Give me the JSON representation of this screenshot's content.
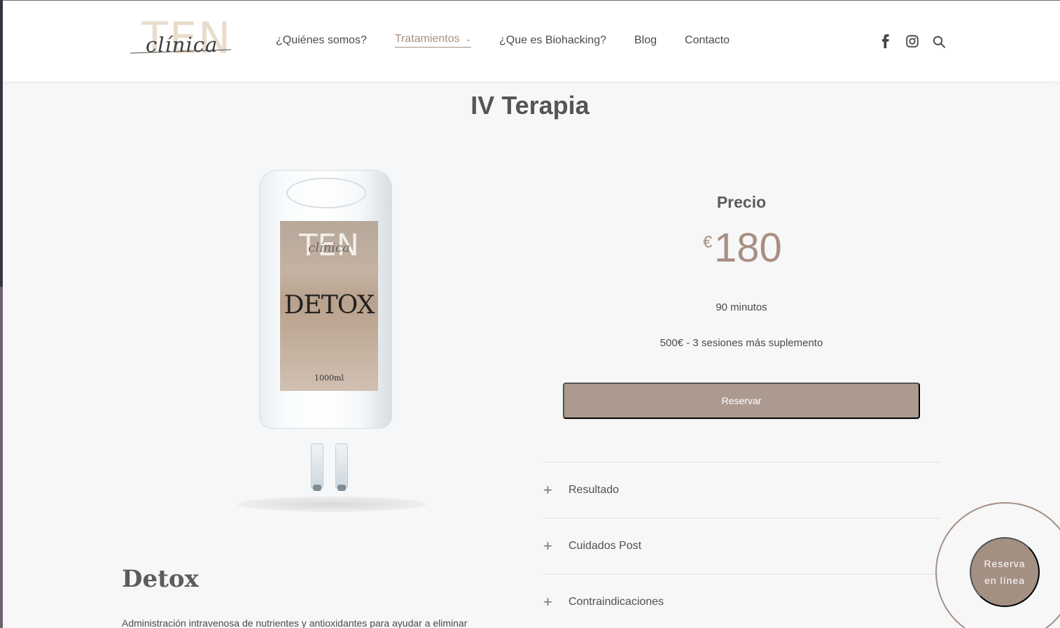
{
  "logo": {
    "top": "TEN",
    "script": "clínica"
  },
  "nav": [
    {
      "label": "¿Quiénes somos?"
    },
    {
      "label": "Tratamientos"
    },
    {
      "label": "¿Que es Biohacking?"
    },
    {
      "label": "Blog"
    },
    {
      "label": "Contacto"
    }
  ],
  "icons": {
    "facebook": "facebook-icon",
    "instagram": "instagram-icon",
    "search": "search-icon"
  },
  "page_title": "IV Terapia",
  "product": {
    "image_label": {
      "brand": "TEN",
      "script": "clínica",
      "name": "DETOX",
      "volume": "1000ml"
    },
    "title": "Detox",
    "description": "Administración intravenosa de nutrientes y antioxidantes para ayudar a eliminar"
  },
  "pricing": {
    "label": "Precio",
    "currency": "€",
    "amount": "180",
    "duration": "90 minutos",
    "package": "500€ - 3 sesiones más suplemento",
    "button": "Reservar"
  },
  "accordion": [
    {
      "label": "Resultado"
    },
    {
      "label": "Cuidados Post"
    },
    {
      "label": "Contraindicaciones"
    }
  ],
  "floating": {
    "text": "Reserva en línea"
  },
  "colors": {
    "accent": "#a88f83",
    "button": "#ac9a90",
    "text": "#4a4a4a"
  }
}
